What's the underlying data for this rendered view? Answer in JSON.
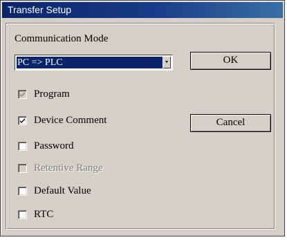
{
  "window": {
    "title": "Transfer Setup"
  },
  "mode": {
    "label": "Communication Mode",
    "selected": "PC => PLC"
  },
  "buttons": {
    "ok": "OK",
    "cancel": "Cancel"
  },
  "options": [
    {
      "label": "Program",
      "checked": true,
      "enabled": false
    },
    {
      "label": "Device Comment",
      "checked": true,
      "enabled": true
    },
    {
      "label": "Password",
      "checked": false,
      "enabled": true
    },
    {
      "label": "Retentive Range",
      "checked": false,
      "enabled": false
    },
    {
      "label": "Default Value",
      "checked": false,
      "enabled": true
    },
    {
      "label": "RTC",
      "checked": false,
      "enabled": true
    }
  ],
  "colors": {
    "title_bar": "#0a246a",
    "selection": "#0a246a",
    "face": "#d4d0c8"
  }
}
